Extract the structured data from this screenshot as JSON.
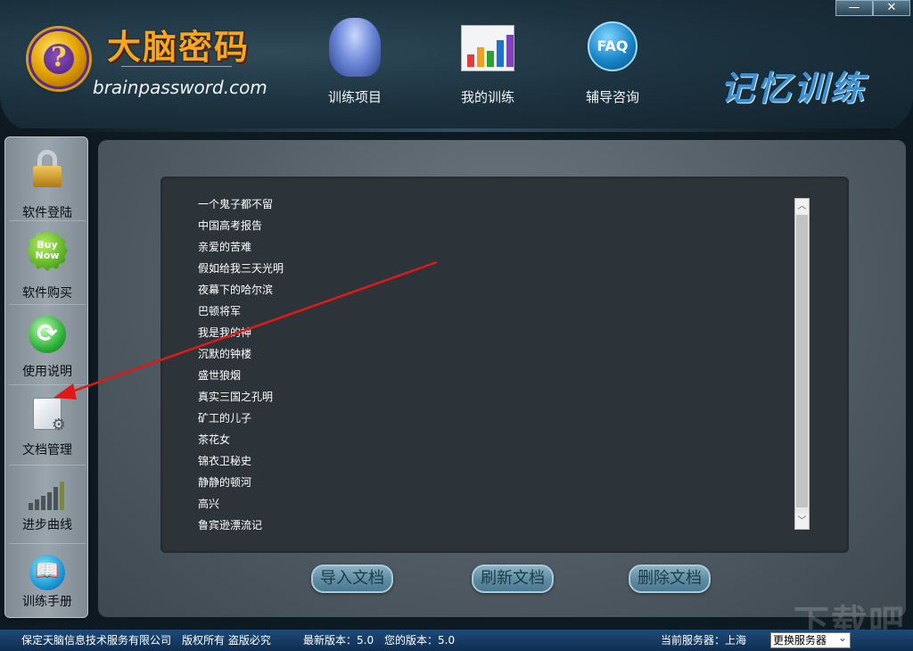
{
  "window": {
    "minimize_label": "—",
    "close_label": "✕"
  },
  "header": {
    "logo_title": "大脑密码",
    "logo_url": "brainpassword.com",
    "brand_right": "记忆训练",
    "nav": [
      {
        "label": "训练项目",
        "icon": "brain-head-icon"
      },
      {
        "label": "我的训练",
        "icon": "bar-chart-icon"
      },
      {
        "label": "辅导咨询",
        "icon": "faq-icon",
        "icon_text": "FAQ"
      }
    ]
  },
  "sidebar": {
    "items": [
      {
        "label": "软件登陆",
        "icon": "lock-user-icon"
      },
      {
        "label": "软件购买",
        "icon": "buy-now-icon",
        "icon_text_1": "Buy",
        "icon_text_2": "Now"
      },
      {
        "label": "使用说明",
        "icon": "refresh-icon"
      },
      {
        "label": "文档管理",
        "icon": "document-gear-icon"
      },
      {
        "label": "进步曲线",
        "icon": "progress-chart-icon"
      },
      {
        "label": "训练手册",
        "icon": "book-icon"
      }
    ]
  },
  "documents": [
    "一个鬼子都不留",
    "中国高考报告",
    "亲爱的苦难",
    "假如给我三天光明",
    "夜幕下的哈尔滨",
    "巴顿将军",
    "我是我的神",
    "沉默的钟楼",
    "盛世狼烟",
    "真实三国之孔明",
    "矿工的儿子",
    "茶花女",
    "锦衣卫秘史",
    "静静的顿河",
    "高兴",
    "鲁宾逊漂流记"
  ],
  "actions": {
    "import_label": "导入文档",
    "refresh_label": "刷新文档",
    "delete_label": "删除文档"
  },
  "footer": {
    "company": "保定天脑信息技术服务有限公司",
    "rights": "版权所有 盗版必究",
    "latest_version": "最新版本：5.0",
    "your_version": "您的版本：5.0",
    "current_server": "当前服务器：上海",
    "change_server_option": "更换服务器"
  },
  "watermark": "下载吧",
  "colors": {
    "accent_orange": "#f7a81a",
    "accent_blue": "#3d8fd0",
    "footer_blue": "#1e4a78",
    "arrow_red": "#e01818"
  }
}
